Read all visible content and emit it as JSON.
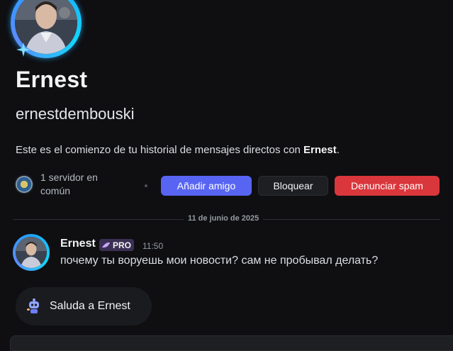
{
  "profile": {
    "display_name": "Ernest",
    "username": "ernestdembouski",
    "intro_prefix": "Este es el comienzo de tu historial de mensajes directos con ",
    "intro_name": "Ernest",
    "intro_suffix": "."
  },
  "mutual": {
    "line1": "1 servidor en",
    "line2": "común",
    "server_icon": "server-icon"
  },
  "actions": {
    "add_friend": "Añadir amigo",
    "block": "Bloquear",
    "report_spam": "Denunciar spam"
  },
  "colors": {
    "add_friend": "#5865f2",
    "report_spam": "#da373c",
    "avatar_ring": "#1fa2ff",
    "pro_badge": "#3b3054"
  },
  "date_divider": "11 de junio de 2025",
  "message": {
    "author": "Ernest",
    "badge": "PRO",
    "time": "11:50",
    "text": "почему ты воруешь мои новости? сам не пробывал делать?"
  },
  "wave": {
    "label": "Saluda a Ernest",
    "icon": "robot-wave-icon"
  }
}
